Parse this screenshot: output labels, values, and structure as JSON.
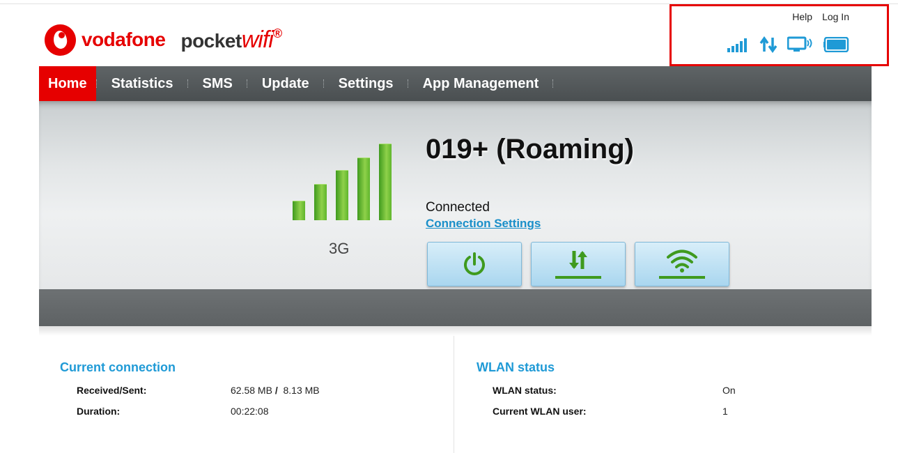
{
  "brand": {
    "name": "vodafone",
    "product_prefix": "pocket",
    "product_suffix": "wifi",
    "registered": "®"
  },
  "top_links": {
    "help": "Help",
    "login": "Log In"
  },
  "status_icons": [
    "signal-strength-icon",
    "data-transfer-icon",
    "connected-device-icon",
    "battery-icon"
  ],
  "nav": {
    "items": [
      {
        "label": "Home",
        "active": true
      },
      {
        "label": "Statistics"
      },
      {
        "label": "SMS"
      },
      {
        "label": "Update"
      },
      {
        "label": "Settings"
      },
      {
        "label": "App Management"
      }
    ]
  },
  "connection": {
    "signal_level": 5,
    "signal_max": 5,
    "network_type": "3G",
    "operator": "019+ (Roaming)",
    "status": "Connected",
    "settings_link": "Connection Settings"
  },
  "current_connection": {
    "title": "Current connection",
    "received_sent_label": "Received/Sent:",
    "received": "62.58 MB",
    "separator": "/",
    "sent": "8.13 MB",
    "duration_label": "Duration:",
    "duration": "00:22:08"
  },
  "wlan": {
    "title": "WLAN status",
    "status_label": "WLAN status:",
    "status_value": "On",
    "users_label": "Current WLAN user:",
    "users_value": "1"
  },
  "colors": {
    "brand_red": "#e60000",
    "accent_blue": "#1f9ad6",
    "signal_green": "#4fa82a",
    "nav_gray": "#54595b"
  }
}
